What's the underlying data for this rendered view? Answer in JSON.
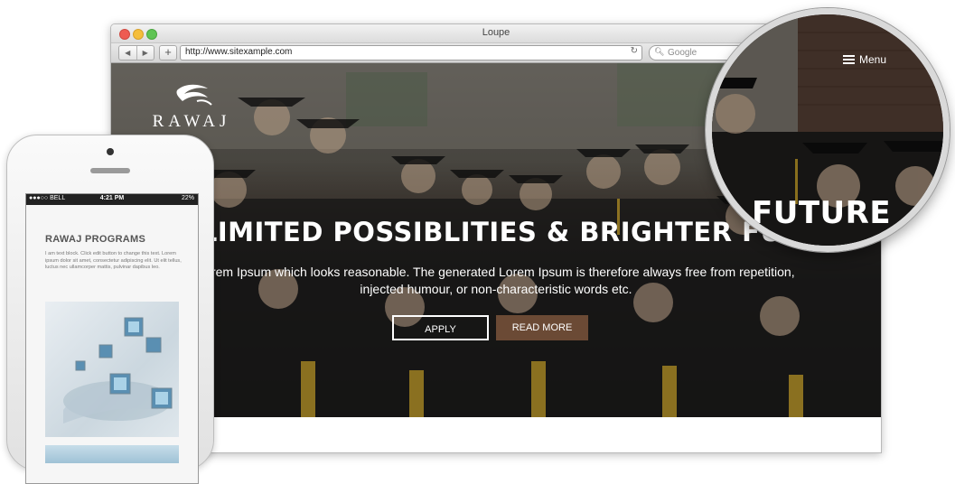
{
  "browser": {
    "window_title": "Loupe",
    "url": "http://www.sitexample.com",
    "search_placeholder": "Google"
  },
  "site": {
    "logo_text": "RAWAJ",
    "hero_title": "UNLIMITED POSSIBLITIES & BRIGHTER FUTURE",
    "hero_subtitle_line1": "Lorem Ipsum which looks reasonable. The generated Lorem Ipsum is therefore always free from repetition,",
    "hero_subtitle_line2": "injected humour, or non-characteristic words etc.",
    "apply_label": "APPLY",
    "read_more_label": "READ MORE",
    "menu_label": "Menu",
    "zoom_word": "FUTURE"
  },
  "phone": {
    "carrier": "●●●○○ BELL",
    "time": "4:21 PM",
    "battery": "22%",
    "programs_title": "RAWAJ PROGRAMS",
    "programs_text": "I am text block. Click edit button to change this text. Lorem ipsum dolor sit amet, consectetur adipiscing elit. Ut elit tellus, luctus nec ullamcorper mattis, pulvinar dapibus leo."
  },
  "colors": {
    "read_more_bg": "#6b4a35",
    "hero_overlay": "#1f1b18"
  }
}
